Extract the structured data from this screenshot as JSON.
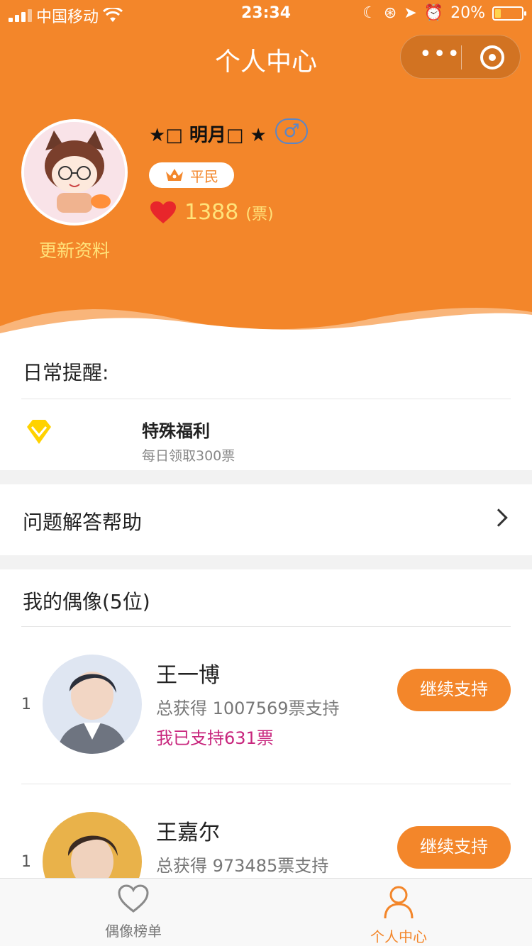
{
  "status_bar": {
    "carrier": "中国移动",
    "time": "23:34",
    "battery": "20%"
  },
  "nav": {
    "title": "个人中心"
  },
  "profile": {
    "nickname": "★□ 明月□ ★",
    "gender_symbol": "♂",
    "rank_label": "平民",
    "votes": "1388",
    "votes_unit": "(票)",
    "update_label": "更新资料"
  },
  "reminder": {
    "title": "日常提醒:",
    "item_title": "特殊福利",
    "item_sub": "每日领取300票"
  },
  "help": {
    "label": "问题解答帮助"
  },
  "idols": {
    "title": "我的偶像(5位)",
    "items": [
      {
        "rank": "1",
        "name": "王一博",
        "total": "总获得 1007569票支持",
        "mine": "我已支持631票",
        "button": "继续支持"
      },
      {
        "rank": "1",
        "name": "王嘉尔",
        "total": "总获得 973485票支持",
        "button": "继续支持"
      }
    ]
  },
  "tabbar": {
    "tabs": [
      {
        "label": "偶像榜单",
        "icon": "heart-outline-icon"
      },
      {
        "label": "个人中心",
        "icon": "person-icon"
      }
    ]
  },
  "colors": {
    "accent": "#f3862a",
    "highlight": "#ffe27a",
    "pink": "#c8267d"
  }
}
